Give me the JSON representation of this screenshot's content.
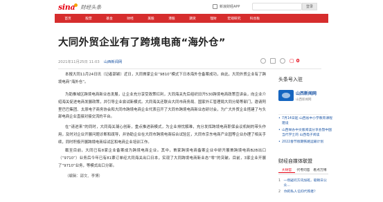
{
  "header": {
    "logo_text": "sina",
    "logo_category": "财经头条",
    "app_link": "新浪财经APP",
    "login_label": "登录"
  },
  "nav": [
    "首页",
    "股票",
    "基金",
    "财经",
    "美股",
    "港股",
    "期货",
    "理财",
    "宏观研究",
    "科创板"
  ],
  "article": {
    "title": "大同外贸企业有了跨境电商“海外仓”",
    "date": "2021年11月25日 11:03",
    "source": "山西新闻网",
    "comment_count": "0",
    "paragraphs": [
      "本报大同11月24日讯（记者郭颖）近日，大同首家企业“9810”模式下日本海外仓备案成功，自此，大同外贸企业有了跨境电商“海外仓”。",
      "为助推域区跨境电商新业态发展，让企业充分享受政策红利，大同海关先后组织旧开530跨境电商政策宣讲会，向企业介绍海关促进电商发展政策，并引导企业尝试新模式。大同海关还联合大同市商务局、国家外汇管理局大同分局等部门，邀请阿里巴巴集团、太原电子商务协会和大同市跨境电商企业代表召开了大同市跨境电商新业态研讨会，为广大外贸企业搭建了与头部电商企业直接对接交流的平台。",
      "在“请进来”的同时，大同海关凝心创新，重点推进新模式，为企业排忧解难，充分发挥跨境电商职保会议机制的带头作用，及时对企业开展问题诊断和疏导，并协助企业在大同市跨境电商综合试验区，大同市京东电商产业园等企业办理了相关手续，同时积极开展跨境电商综试区和电商企业培训工作。",
      "截至目前，大同已有8家企业备案成为跨境电商企业。其中，首家跨境电商备案企业中研开展首跨境电商B2B出口（“9710”）业务后今年已有81票订单经大同海关出口日本，实现了大同跨境电商新业态“零”的突破。目前，3家企业开展了“9710”业务，等模式出口分部。"
    ],
    "author": "（编辑：邵文、李博）"
  },
  "sidebar": {
    "account_heading": "头条号入驻",
    "account_name": "山西新闻网",
    "account_sub": "山西新闻网",
    "news": [
      "7月14日起 山西省中小学教育课程建设",
      "山西举办中文版阅读分享会暨中国当代学士的 山西电子阅读",
      "2022春节假期铁路运输计划"
    ],
    "hot_heading": "财经自媒体联盟",
    "tabs": [
      "大财官",
      "代考问答",
      "看点万博"
    ],
    "rank": [
      "一场疑问方讯加班，吸睛日公众...",
      "你的私人信仰代购者？"
    ]
  },
  "colors": {
    "brand_red": "#e60012",
    "nav_red": "#d62d2d",
    "link_blue": "#1e57a6"
  }
}
